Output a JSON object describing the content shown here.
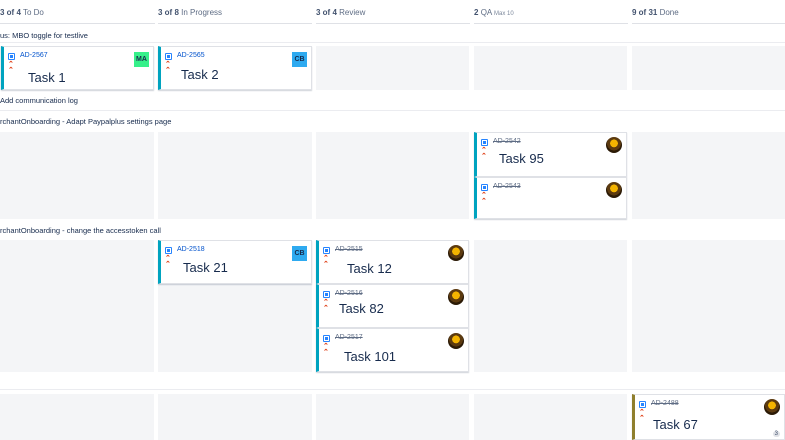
{
  "columns": [
    {
      "count": "3 of 4",
      "name": "To Do",
      "max": ""
    },
    {
      "count": "3 of 8",
      "name": "In Progress",
      "max": ""
    },
    {
      "count": "3 of 4",
      "name": "Review",
      "max": ""
    },
    {
      "count": "2",
      "name": "QA",
      "max": "Max 10"
    },
    {
      "count": "9 of 31",
      "name": "Done",
      "max": ""
    }
  ],
  "swimlanes": [
    {
      "title": "us: MBO toggle for testlive"
    },
    {
      "title": "Add communication log"
    },
    {
      "title": "rchantOnboarding - Adapt Paypalplus settings page"
    },
    {
      "title": "rchantOnboarding - change the accesstoken call"
    }
  ],
  "cards": [
    {
      "key": "AD-2567",
      "summary": "Task 1",
      "assignee": "MA",
      "assignee_color": "#36f08a",
      "done": false
    },
    {
      "key": "AD-2565",
      "summary": "Task 2",
      "assignee": "CB",
      "assignee_color": "#2eaaf0",
      "done": false
    },
    {
      "key": "AD-2542",
      "summary": "Task 95",
      "assignee": "photo",
      "done": true
    },
    {
      "key": "AD-2543",
      "summary": "",
      "assignee": "photo",
      "done": true
    },
    {
      "key": "AD-2518",
      "summary": "Task 21",
      "assignee": "CB",
      "assignee_color": "#2eaaf0",
      "done": false
    },
    {
      "key": "AD-2515",
      "summary": "Task 12",
      "assignee": "photo",
      "done": true
    },
    {
      "key": "AD-2516",
      "summary": "Task 82",
      "assignee": "photo",
      "done": true
    },
    {
      "key": "AD-2517",
      "summary": "Task 101",
      "assignee": "photo",
      "done": true
    },
    {
      "key": "AD-2488",
      "summary": "Task 67",
      "assignee": "photo",
      "done": true,
      "badge": "3"
    }
  ],
  "colors": {
    "accent_teal": "#00a3bf",
    "accent_olive": "#8f7f2e",
    "priority": "#de350b",
    "link": "#0052cc"
  },
  "icons": {
    "issue_type": "story-square-icon",
    "priority": "priority-high-icon"
  }
}
